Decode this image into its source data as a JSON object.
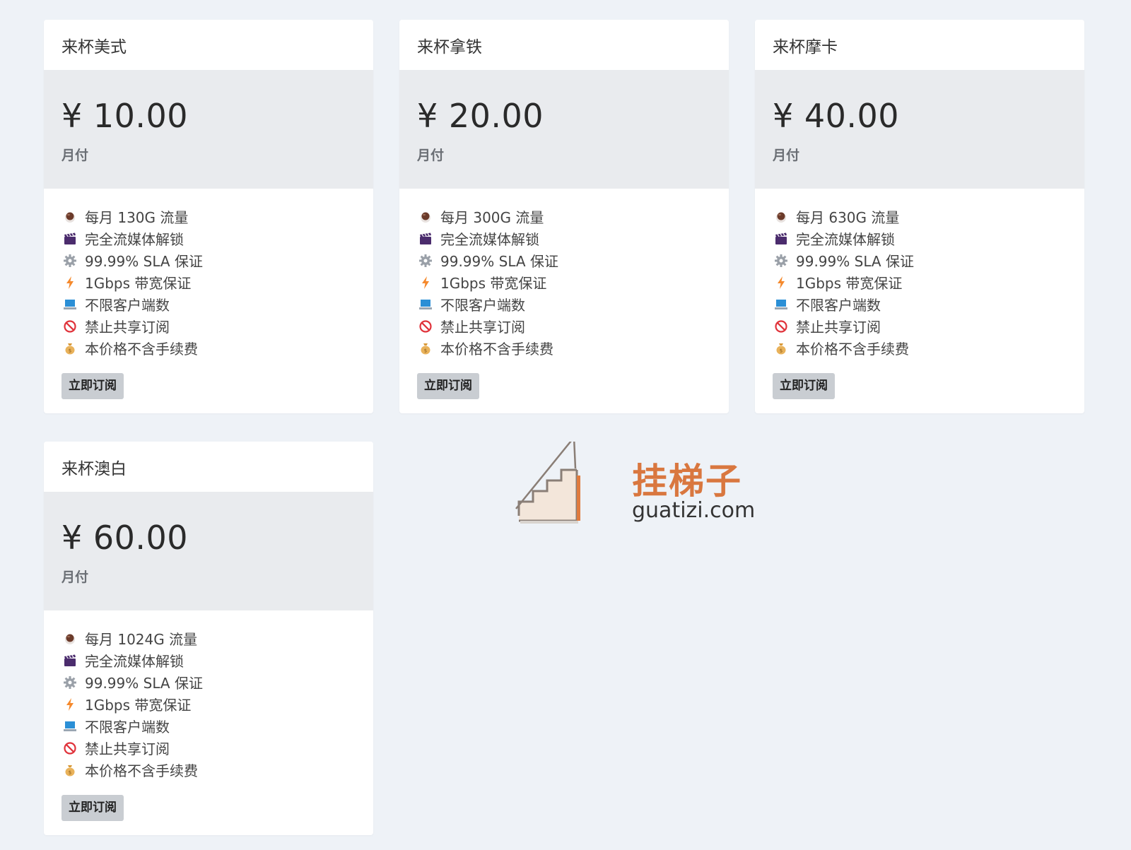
{
  "plans": [
    {
      "name": "来杯美式",
      "price": "¥ 10.00",
      "period": "月付",
      "features": [
        "每月 130G 流量",
        "完全流媒体解锁",
        "99.99% SLA 保证",
        "1Gbps 带宽保证",
        "不限客户端数",
        "禁止共享订阅",
        "本价格不含手续费"
      ],
      "button": "立即订阅"
    },
    {
      "name": "来杯拿铁",
      "price": "¥ 20.00",
      "period": "月付",
      "features": [
        "每月 300G 流量",
        "完全流媒体解锁",
        "99.99% SLA 保证",
        "1Gbps 带宽保证",
        "不限客户端数",
        "禁止共享订阅",
        "本价格不含手续费"
      ],
      "button": "立即订阅"
    },
    {
      "name": "来杯摩卡",
      "price": "¥ 40.00",
      "period": "月付",
      "features": [
        "每月 630G 流量",
        "完全流媒体解锁",
        "99.99% SLA 保证",
        "1Gbps 带宽保证",
        "不限客户端数",
        "禁止共享订阅",
        "本价格不含手续费"
      ],
      "button": "立即订阅"
    },
    {
      "name": "来杯澳白",
      "price": "¥ 60.00",
      "period": "月付",
      "features": [
        "每月 1024G 流量",
        "完全流媒体解锁",
        "99.99% SLA 保证",
        "1Gbps 带宽保证",
        "不限客户端数",
        "禁止共享订阅",
        "本价格不含手续费"
      ],
      "button": "立即订阅"
    }
  ],
  "feature_icons": [
    "coffee-icon",
    "clapper-board-icon",
    "gear-icon",
    "lightning-icon",
    "laptop-icon",
    "prohibited-icon",
    "money-bag-icon"
  ],
  "watermark": {
    "cn": "挂梯子",
    "en": "guatizi.com"
  },
  "colors": {
    "background": "#eef2f7",
    "price_block": "#e9ebee",
    "button": "#c9cdd2",
    "watermark_accent": "#d9773f"
  }
}
